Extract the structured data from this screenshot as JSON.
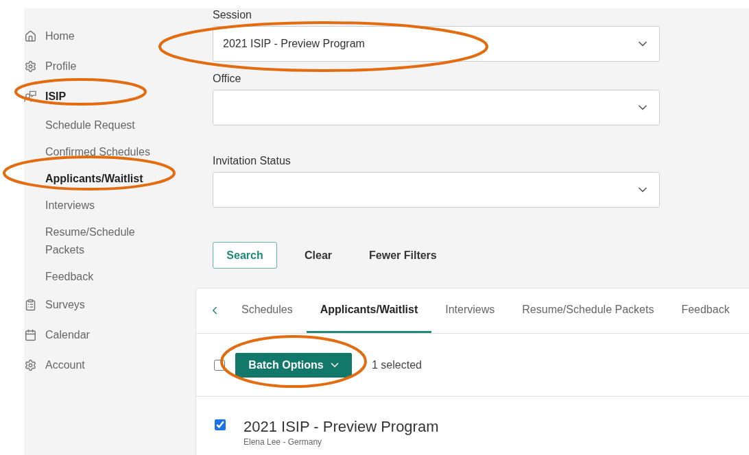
{
  "sidebar": {
    "items": [
      {
        "label": "Home"
      },
      {
        "label": "Profile"
      },
      {
        "label": "ISIP",
        "expanded": true,
        "children": [
          {
            "label": "Schedule Request",
            "selected": false
          },
          {
            "label": "Confirmed Schedules",
            "selected": false
          },
          {
            "label": "Applicants/Waitlist",
            "selected": true
          },
          {
            "label": "Interviews",
            "selected": false
          },
          {
            "label": "Resume/Schedule Packets",
            "selected": false
          },
          {
            "label": "Feedback",
            "selected": false
          }
        ]
      },
      {
        "label": "Surveys"
      },
      {
        "label": "Calendar"
      },
      {
        "label": "Account"
      }
    ]
  },
  "filters": [
    {
      "label": "Session",
      "value": "2021 ISIP - Preview Program"
    },
    {
      "label": "Office"
    },
    {
      "label": "Invitation Status"
    }
  ],
  "actions": {
    "search": "Search",
    "clear": "Clear",
    "fewer": "Fewer Filters"
  },
  "tabs": [
    {
      "label": "Schedules",
      "selected": false
    },
    {
      "label": "Applicants/Waitlist",
      "selected": true
    },
    {
      "label": "Interviews",
      "selected": false
    },
    {
      "label": "Resume/Schedule Packets",
      "selected": false
    },
    {
      "label": "Feedback",
      "selected": false
    }
  ],
  "batch": {
    "checked": false,
    "button": "Batch Options",
    "count": "1 selected"
  },
  "results": [
    {
      "title": "2021 ISIP - Preview Program",
      "subtitle": "Elena Lee - Germany",
      "checked": true
    }
  ]
}
